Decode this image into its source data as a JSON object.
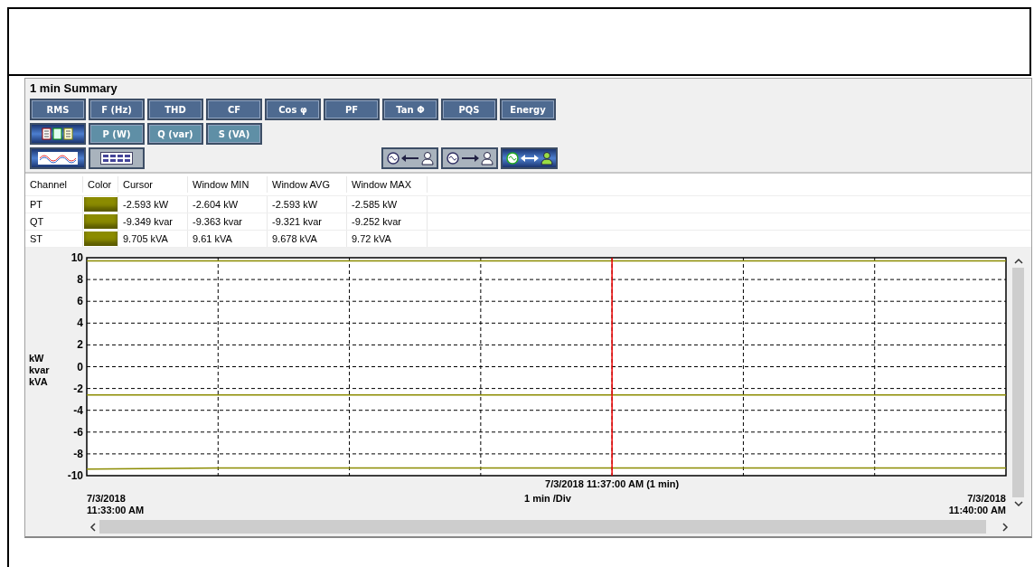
{
  "panel": {
    "title": "1 min Summary"
  },
  "toolbar": {
    "rows": [
      [
        {
          "kind": "text",
          "label": "RMS"
        },
        {
          "kind": "text",
          "label": "F (Hz)"
        },
        {
          "kind": "text",
          "label": "THD"
        },
        {
          "kind": "text",
          "label": "CF"
        },
        {
          "kind": "text",
          "label": "Cos φ"
        },
        {
          "kind": "text",
          "label": "PF"
        },
        {
          "kind": "text",
          "label": "Tan Φ"
        },
        {
          "kind": "text",
          "label": "PQS"
        },
        {
          "kind": "text",
          "label": "Energy"
        }
      ],
      [
        {
          "kind": "meters",
          "selected": true
        },
        {
          "kind": "text",
          "label": "P (W)"
        },
        {
          "kind": "text",
          "label": "Q (var)"
        },
        {
          "kind": "text",
          "label": "S (VA)"
        }
      ],
      [
        {
          "kind": "waveform",
          "selected": true
        },
        {
          "kind": "grid",
          "selected": false
        }
      ]
    ]
  },
  "direction_buttons": [
    {
      "kind": "left",
      "selected": false
    },
    {
      "kind": "right",
      "selected": false
    },
    {
      "kind": "both",
      "selected": true
    }
  ],
  "table": {
    "columns": [
      "Channel",
      "Color",
      "Cursor",
      "Window MIN",
      "Window AVG",
      "Window MAX"
    ],
    "rows": [
      {
        "channel": "PT",
        "color": "#8b8b00",
        "cursor": "-2.593 kW",
        "min": "-2.604 kW",
        "avg": "-2.593 kW",
        "max": "-2.585 kW"
      },
      {
        "channel": "QT",
        "color": "#8b8b00",
        "cursor": "-9.349 kvar",
        "min": "-9.363 kvar",
        "avg": "-9.321 kvar",
        "max": "-9.252 kvar"
      },
      {
        "channel": "ST",
        "color": "#8b8b00",
        "cursor": "9.705 kVA",
        "min": "9.61 kVA",
        "avg": "9.678 kVA",
        "max": "9.72 kVA"
      }
    ]
  },
  "chart": {
    "y_units": [
      "kW",
      "kvar",
      "kVA"
    ],
    "cursor": {
      "level": 0.5714,
      "label": "7/3/2018 11:37:00 AM (1 min)"
    },
    "division_label": "1 min /Div",
    "start": {
      "date": "7/3/2018",
      "time": "11:33:00 AM"
    },
    "end": {
      "date": "7/3/2018",
      "time": "11:40:00 AM"
    },
    "chart_data": {
      "type": "line",
      "grid": true,
      "categories": [
        null,
        null,
        null,
        null,
        null,
        null,
        null,
        null
      ],
      "ylim": [
        -10,
        10
      ],
      "yticks": [
        -10,
        -8,
        -6,
        -4,
        -2,
        0,
        2,
        4,
        6,
        8,
        10
      ],
      "series": [
        {
          "color": "#8b8b00",
          "values": [
            -2.6,
            -2.6,
            -2.6,
            -2.6,
            -2.6,
            -2.6,
            -2.6,
            -2.6
          ]
        },
        {
          "color": "#8b8b00",
          "values": [
            -9.4,
            -9.3,
            -9.3,
            -9.3,
            -9.3,
            -9.3,
            -9.3,
            -9.3
          ]
        },
        {
          "color": "#8b8b00",
          "values": [
            9.7,
            9.7,
            9.7,
            9.7,
            9.7,
            9.7,
            9.7,
            9.7
          ]
        }
      ]
    }
  }
}
